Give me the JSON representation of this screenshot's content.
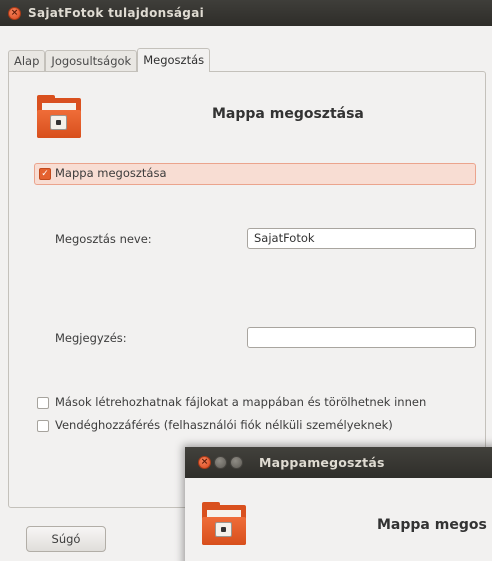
{
  "window": {
    "title": "SajatFotok tulajdonságai"
  },
  "tabs": [
    {
      "label": "Alap"
    },
    {
      "label": "Jogosultságok"
    },
    {
      "label": "Megosztás"
    }
  ],
  "share": {
    "heading": "Mappa megosztása",
    "share_checkbox_label": "Mappa megosztása",
    "share_checked": true,
    "name_label": "Megosztás neve:",
    "name_value": "SajatFotok",
    "comment_label": "Megjegyzés:",
    "comment_value": "",
    "allow_others_label": "Mások létrehozhatnak fájlokat a mappában és törölhetnek innen",
    "allow_others_checked": false,
    "guest_label": "Vendéghozzáférés (felhasználói fiók nélküli személyeknek)",
    "guest_checked": false
  },
  "footer": {
    "help_label": "Súgó"
  },
  "overlay_dialog": {
    "title": "Mappamegosztás",
    "heading": "Mappa megos"
  },
  "icons": [
    "close-icon",
    "folder-share-icon",
    "checkbox-icon",
    "minimize-icon",
    "maximize-icon"
  ],
  "colors": {
    "accent": "#dd4814",
    "titlebar": "#3c3b37",
    "highlight_row": "#f8ddd3"
  }
}
